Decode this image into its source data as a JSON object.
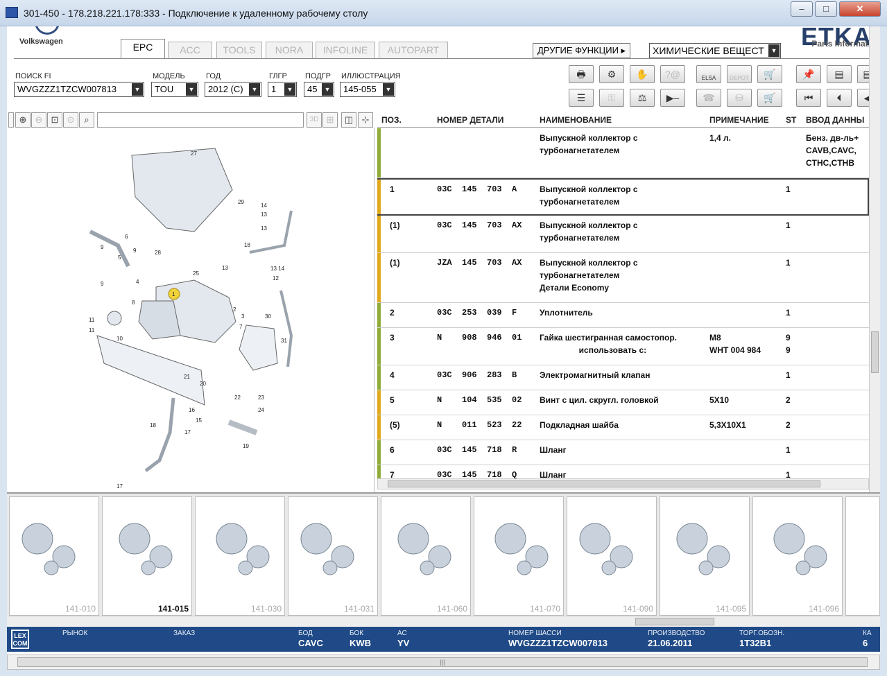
{
  "window": {
    "title": "301-450 - 178.218.221.178:333 - Подключение к удаленному рабочему столу",
    "minimize": "–",
    "maximize": "□",
    "close": "✕"
  },
  "brand": {
    "name": "Volkswagen",
    "logo_text": "ETKA",
    "logo_sub": "Parts Informati"
  },
  "tabs": [
    {
      "label": "EPC",
      "active": true
    },
    {
      "label": "ACC",
      "active": false
    },
    {
      "label": "TOOLS",
      "active": false
    },
    {
      "label": "NORA",
      "active": false
    },
    {
      "label": "INFOLINE",
      "active": false
    },
    {
      "label": "AUTOPART",
      "active": false
    }
  ],
  "other_functions": {
    "label": "ДРУГИЕ ФУНКЦИИ ▸",
    "selected": "ХИМИЧЕСКИЕ ВЕЩЕСТ"
  },
  "filters": {
    "search_fi": {
      "label": "ПОИСК FI",
      "value": "WVGZZZ1TZCW007813"
    },
    "model": {
      "label": "МОДЕЛЬ",
      "value": "TOU"
    },
    "year": {
      "label": "ГОД",
      "value": "2012 (C)"
    },
    "main_group": {
      "label": "ГЛГР",
      "value": "1"
    },
    "sub_group": {
      "label": "ПОДГР",
      "value": "45"
    },
    "illustration": {
      "label": "ИЛЛЮСТРАЦИЯ",
      "value": "145-055"
    }
  },
  "toolbar_icons": [
    "print-icon",
    "service-icon",
    "handshake-icon",
    "contact-icon",
    "elsa-icon",
    "depot-icon",
    "cart-icon",
    "pin-icon",
    "page-icon",
    "page2-icon",
    "list-icon",
    "key-icon",
    "scale-icon",
    "play-icon",
    "basket-icon",
    "first-icon",
    "prev-icon",
    "back-icon"
  ],
  "toolbar_text": {
    "elsa": "ELSA",
    "depot": "DEPOT"
  },
  "table": {
    "headers": {
      "pos": "ПОЗ.",
      "part": "НОМЕР ДЕТАЛИ",
      "name": "НАИМЕНОВАНИЕ",
      "note": "ПРИМЕЧАНИЕ",
      "st": "ST",
      "input": "ВВОД ДАННЫ"
    },
    "rows": [
      {
        "pos": "",
        "part": "",
        "name": "Выпускной коллектор с\nтурбонагнетателем",
        "note": "1,4 л.",
        "st": "",
        "input": "Бенз. дв-ль+\nCAVB,CAVC,\nCTHC,CTHB",
        "bar": "#8fac3a"
      },
      {
        "pos": "1",
        "part": "03C  145  703  A",
        "name": "Выпускной коллектор с\nтурбонагнетателем",
        "note": "",
        "st": "1",
        "input": "",
        "bar": "#e0a91c",
        "selected": true
      },
      {
        "pos": "(1)",
        "part": "03C  145  703  AX",
        "name": "Выпускной коллектор с\nтурбонагнетателем",
        "note": "",
        "st": "1",
        "input": "",
        "bar": "#e0a91c"
      },
      {
        "pos": "(1)",
        "part": "JZA  145  703  AX",
        "name": "Выпускной коллектор с\nтурбонагнетателем\nДетали Economy",
        "note": "",
        "st": "1",
        "input": "",
        "bar": "#e0a91c"
      },
      {
        "pos": "2",
        "part": "03C  253  039  F",
        "name": "Уплотнитель",
        "note": "",
        "st": "1",
        "input": "",
        "bar": "#8fac3a"
      },
      {
        "pos": "3",
        "part": "N    908  946  01",
        "name": "Гайка шестигранная самостопор.\n                 использовать с:",
        "note": "M8\nWHT 004 984",
        "st": "9\n9",
        "input": "",
        "bar": "#8fac3a"
      },
      {
        "pos": "4",
        "part": "03C  906  283  B",
        "name": "Электромагнитный клапан",
        "note": "",
        "st": "1",
        "input": "",
        "bar": "#8fac3a"
      },
      {
        "pos": "5",
        "part": "N    104  535  02",
        "name": "Винт с цил. скругл. головкой",
        "note": "5X10",
        "st": "2",
        "input": "",
        "bar": "#e0a91c"
      },
      {
        "pos": "(5)",
        "part": "N    011  523  22",
        "name": "Подкладная шайба",
        "note": "5,3X10X1",
        "st": "2",
        "input": "",
        "bar": "#e0a91c"
      },
      {
        "pos": "6",
        "part": "03C  145  718  R",
        "name": "Шланг",
        "note": "",
        "st": "1",
        "input": "",
        "bar": "#8fac3a"
      },
      {
        "pos": "7",
        "part": "03C  145  718  Q",
        "name": "Шланг",
        "note": "",
        "st": "1",
        "input": "",
        "bar": "#8fac3a"
      }
    ]
  },
  "diagram": {
    "callouts": [
      "27",
      "29",
      "14",
      "13",
      "13",
      "6",
      "9",
      "28",
      "18",
      "9",
      "5",
      "25",
      "13",
      "12",
      "13 14",
      "4",
      "1",
      "9",
      "8",
      "2",
      "3",
      "30",
      "7",
      "10",
      "11",
      "11",
      "31",
      "21",
      "20",
      "22",
      "23",
      "24",
      "16",
      "15",
      "18",
      "17",
      "19",
      "17"
    ]
  },
  "thumbnails": [
    {
      "code": "141-010",
      "current": false
    },
    {
      "code": "141-015",
      "current": true
    },
    {
      "code": "141-030",
      "current": false
    },
    {
      "code": "141-031",
      "current": false
    },
    {
      "code": "141-060",
      "current": false
    },
    {
      "code": "141-070",
      "current": false
    },
    {
      "code": "141-090",
      "current": false
    },
    {
      "code": "141-095",
      "current": false
    },
    {
      "code": "141-096",
      "current": false
    }
  ],
  "status": {
    "logo": "LEX\nCOM",
    "market": {
      "label": "РЫНОК",
      "value": ""
    },
    "order": {
      "label": "ЗАКАЗ",
      "value": ""
    },
    "bod": {
      "label": "БОД",
      "value": "CAVC"
    },
    "bok": {
      "label": "БОК",
      "value": "KWB"
    },
    "ac": {
      "label": "АС",
      "value": "YV"
    },
    "chassis": {
      "label": "НОМЕР ШАССИ",
      "value": "WVGZZZ1TZCW007813"
    },
    "production": {
      "label": "ПРОИЗВОДСТВО",
      "value": "21.06.2011"
    },
    "trade": {
      "label": "ТОРГ.ОБОЗН.",
      "value": "1T32B1"
    },
    "extra": {
      "label": "КА",
      "value": "6"
    }
  },
  "bottom_scroll": {
    "grip": "|||"
  }
}
